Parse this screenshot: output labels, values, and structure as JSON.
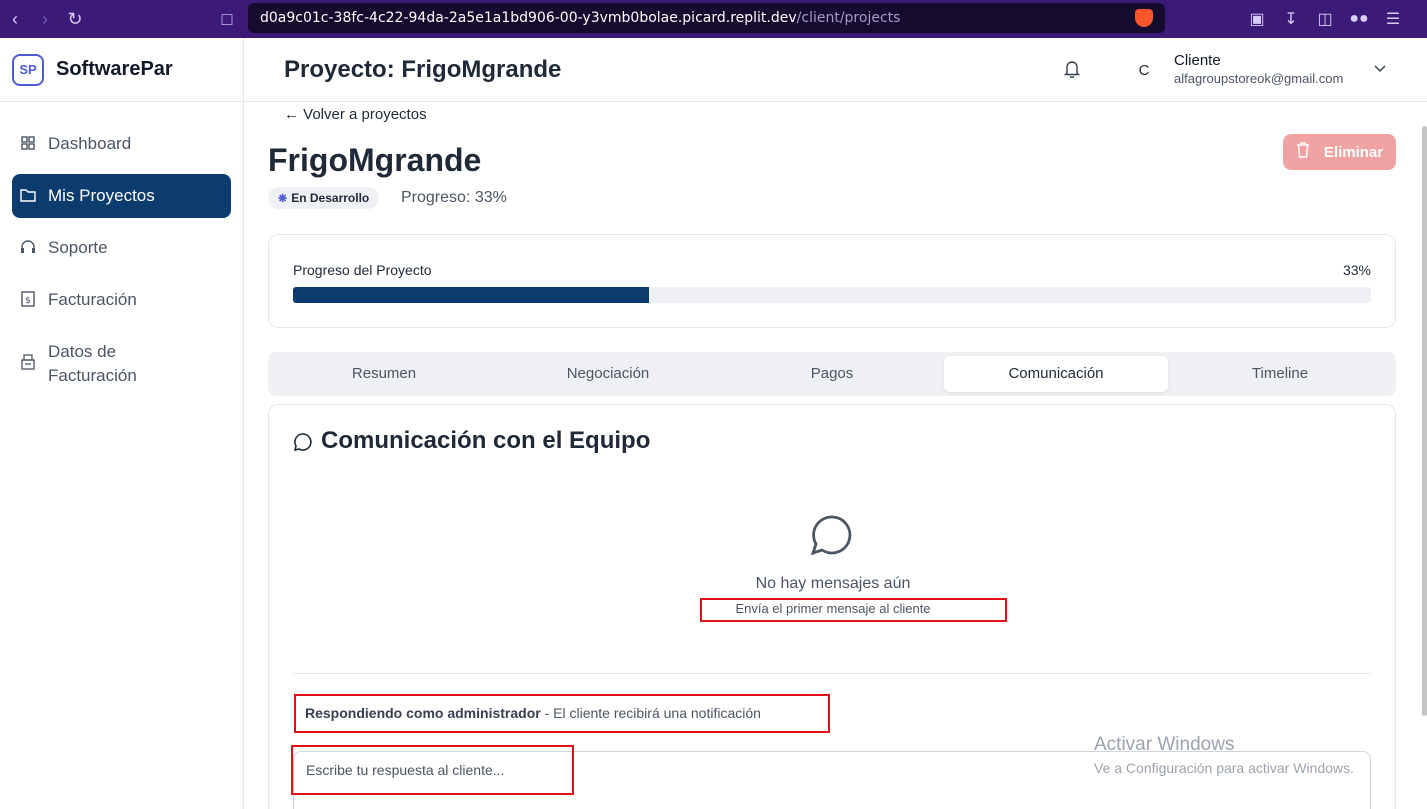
{
  "browser": {
    "url_host": "d0a9c01c-38fc-4c22-94da-2a5e1a1bd906-00-y3vmb0bolae.picard.replit.dev",
    "url_path": "/client/projects"
  },
  "sidebar": {
    "brand": "SoftwarePar",
    "items": [
      {
        "label": "Dashboard",
        "icon": "grid-icon"
      },
      {
        "label": "Mis Proyectos",
        "icon": "folder-icon"
      },
      {
        "label": "Soporte",
        "icon": "headset-icon"
      },
      {
        "label": "Facturación",
        "icon": "invoice-icon"
      },
      {
        "label": "Datos de Facturación",
        "icon": "register-icon"
      }
    ]
  },
  "header": {
    "title": "Proyecto: FrigoMgrande",
    "avatar_initial": "C",
    "user_name": "Cliente",
    "user_email": "alfagroupstoreok@gmail.com"
  },
  "project": {
    "back_label": "← Volver a proyectos",
    "name": "FrigoMgrande",
    "status": "En Desarrollo",
    "progress_text": "Progreso: 33%",
    "delete_label": "Eliminar",
    "progress_card_label": "Progreso del Proyecto",
    "progress_value_label": "33%",
    "progress_fraction": 0.33
  },
  "tabs": [
    {
      "label": "Resumen",
      "active": false
    },
    {
      "label": "Negociación",
      "active": false
    },
    {
      "label": "Pagos",
      "active": false
    },
    {
      "label": "Comunicación",
      "active": true
    },
    {
      "label": "Timeline",
      "active": false
    }
  ],
  "communication": {
    "title": "Comunicación con el Equipo",
    "empty_title": "No hay mensajes aún",
    "empty_subtitle": "Envía el primer mensaje al cliente",
    "reply_role": "Respondiendo como administrador",
    "reply_note": " - El cliente recibirá una notificación",
    "reply_placeholder": "Escribe tu respuesta al cliente..."
  },
  "watermark": {
    "line1": "Activar Windows",
    "line2": "Ve a Configuración para activar Windows."
  },
  "colors": {
    "primary": "#0c3b6e",
    "browser_chrome": "#3b1a78",
    "delete": "#f0a3a3",
    "highlight": "#e0101a"
  }
}
